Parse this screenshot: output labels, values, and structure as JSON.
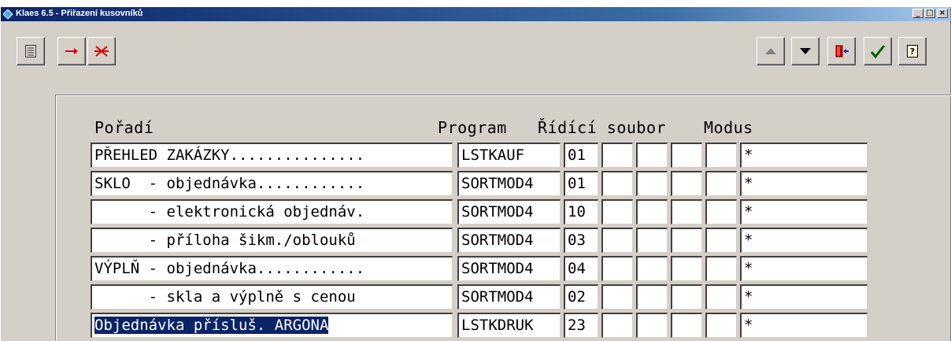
{
  "window": {
    "title": "Klaes 6.5 - Přiřazení kusovníků",
    "controls": [
      "_",
      "□",
      "×"
    ]
  },
  "toolbar": {
    "left": [
      {
        "icon": "list-icon"
      },
      {
        "icon": "remove-icon"
      },
      {
        "icon": "delete-icon"
      }
    ],
    "right": [
      {
        "icon": "arrow-up-icon"
      },
      {
        "icon": "arrow-down-icon"
      },
      {
        "icon": "exit-door-icon"
      },
      {
        "icon": "checkmark-icon"
      },
      {
        "icon": "help-icon"
      }
    ]
  },
  "headers": {
    "poradi": "Pořadí",
    "program": "Program",
    "ridici_soubor": "Řídící soubor",
    "modus": "Modus"
  },
  "rows": [
    {
      "poradi": "PŘEHLED ZAKÁZKY...............",
      "program": "LSTKAUF",
      "code": "01",
      "f1": "",
      "f2": "",
      "f3": "",
      "f4": "",
      "modus": "*",
      "selected": false
    },
    {
      "poradi": "SKLO  - objednávka............",
      "program": "SORTMOD4",
      "code": "01",
      "f1": "",
      "f2": "",
      "f3": "",
      "f4": "",
      "modus": "*",
      "selected": false
    },
    {
      "poradi": "      - elektronická objednáv.",
      "program": "SORTMOD4",
      "code": "10",
      "f1": "",
      "f2": "",
      "f3": "",
      "f4": "",
      "modus": "*",
      "selected": false
    },
    {
      "poradi": "      - příloha šikm./oblouků",
      "program": "SORTMOD4",
      "code": "03",
      "f1": "",
      "f2": "",
      "f3": "",
      "f4": "",
      "modus": "*",
      "selected": false
    },
    {
      "poradi": "VÝPLŇ - objednávka............",
      "program": "SORTMOD4",
      "code": "04",
      "f1": "",
      "f2": "",
      "f3": "",
      "f4": "",
      "modus": "*",
      "selected": false
    },
    {
      "poradi": "      - skla a výplně s cenou",
      "program": "SORTMOD4",
      "code": "02",
      "f1": "",
      "f2": "",
      "f3": "",
      "f4": "",
      "modus": "*",
      "selected": false
    },
    {
      "poradi": "Objednávka přísluš. ARGONA",
      "program": "LSTKDRUK",
      "code": "23",
      "f1": "",
      "f2": "",
      "f3": "",
      "f4": "",
      "modus": "*",
      "selected": true
    }
  ]
}
